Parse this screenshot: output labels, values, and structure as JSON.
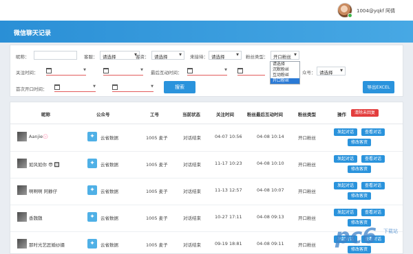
{
  "user": {
    "name": "1004@yqkf 阿倩"
  },
  "header": {
    "title": "微信聊天记录"
  },
  "filters": {
    "nickname_label": "昵称：",
    "customer_service_label": "客服：",
    "customer_service_value": "请选择",
    "consultant_label": "客资：",
    "consultant_value": "请选择",
    "receiver_label": "来接待：",
    "receiver_value": "请选择",
    "fan_type_label": "粉丝类型：",
    "fan_type_value": "开口粉丝",
    "fan_type_options": [
      "请选择",
      "沉默粉丝",
      "互动粉丝",
      "开口粉丝"
    ],
    "follow_time_label": "关注时间：",
    "last_interaction_label": "最后互动时间：",
    "official_account_label": "众号：",
    "official_account_value": "请选择",
    "first_open_label": "首次开口时间：",
    "search_button": "搜索",
    "export_button": "导出EXCEL"
  },
  "table": {
    "columns": {
      "nickname": "昵称",
      "official_account": "公众号",
      "work_id": "工号",
      "status": "当前状态",
      "follow_time": "关注时间",
      "last_interaction": "粉丝最后互动时间",
      "fan_type": "粉丝类型",
      "actions": "操作",
      "clear_unreplied": "清除未回复"
    },
    "action_labels": {
      "start_chat": "发起对话",
      "view_chat": "查看对话",
      "edit_profile": "修改客资"
    },
    "rows": [
      {
        "nickname": "Aanjie💮",
        "official_account": "云省数据",
        "work_id": "1005 麦子",
        "status": "对话结束",
        "follow_time": "04-07 10:56",
        "last_interaction": "04-08 10:14",
        "fan_type": "开口粉丝"
      },
      {
        "nickname": "如风如你 😎 🔲",
        "official_account": "云省数据",
        "work_id": "1005 麦子",
        "status": "对话结束",
        "follow_time": "11-17 10:23",
        "last_interaction": "04-08 10:10",
        "fan_type": "开口粉丝"
      },
      {
        "nickname": "啊啊啊 阿静仔",
        "official_account": "云省数据",
        "work_id": "1005 麦子",
        "status": "对话结束",
        "follow_time": "11-13 12:57",
        "last_interaction": "04-08 10:07",
        "fan_type": "开口粉丝"
      },
      {
        "nickname": "香魏魏",
        "official_account": "云省数据",
        "work_id": "1005 麦子",
        "status": "对话结束",
        "follow_time": "10-27 17:11",
        "last_interaction": "04-08 09:13",
        "fan_type": "开口粉丝"
      },
      {
        "nickname": "那时光艺匠婚纱摄",
        "official_account": "云省数据",
        "work_id": "1005 麦子",
        "status": "对话结束",
        "follow_time": "09-19 18:81",
        "last_interaction": "04-08 09:11",
        "fan_type": "开口粉丝"
      }
    ]
  },
  "watermark": {
    "brand": "pc6",
    "line1": "下载站"
  },
  "colors": {
    "accent": "#2a93dc",
    "danger": "#e33d3d",
    "header_gradient": "#2a8fd6"
  }
}
